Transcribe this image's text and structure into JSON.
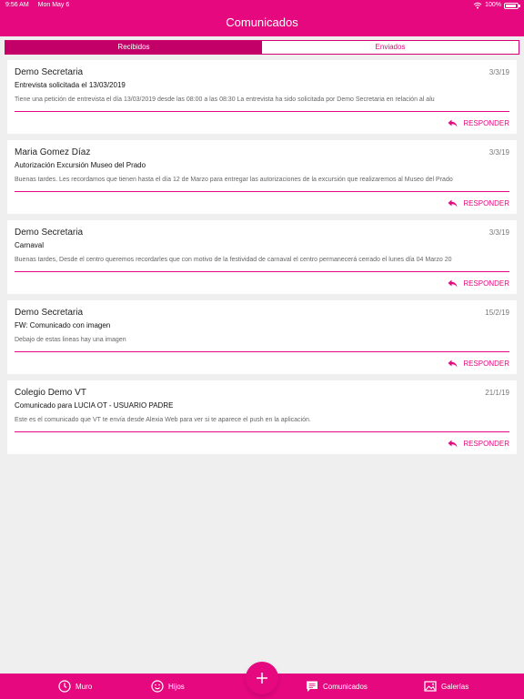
{
  "status": {
    "time": "9:56 AM",
    "date": "Mon May 6",
    "battery": "100%"
  },
  "header": {
    "title": "Comunicados"
  },
  "tabs": [
    {
      "label": "Recibidos"
    },
    {
      "label": "Enviados"
    }
  ],
  "messages": [
    {
      "sender": "Demo Secretaria",
      "date": "3/3/19",
      "subject": "Entrevista solicitada el 13/03/2019",
      "body": "Tiene una petición de entrevista el día 13/03/2019 desde las 08:00 a las 08:30 La entrevista ha sido solicitada por Demo Secretaria en relación al alu",
      "reply": "RESPONDER"
    },
    {
      "sender": "Maria Gomez Díaz",
      "date": "3/3/19",
      "subject": "Autorización Excursión Museo del Prado",
      "body": "Buenas tardes. Les recordamos que tienen hasta el día 12 de Marzo para entregar las autorizaciones de la excursión que realizaremos al Museo del Prado",
      "reply": "RESPONDER"
    },
    {
      "sender": "Demo Secretaria",
      "date": "3/3/19",
      "subject": "Carnaval",
      "body": "Buenas tardes, Desde el centro queremos recordarles que con motivo de la festividad de carnaval el centro permanecerá cerrado el lunes día 04 Marzo 20",
      "reply": "RESPONDER"
    },
    {
      "sender": "Demo Secretaria",
      "date": "15/2/19",
      "subject": "FW: Comunicado con imagen",
      "body": "Debajo de estas lineas hay una imagen",
      "reply": "RESPONDER"
    },
    {
      "sender": "Colegio Demo VT",
      "date": "21/1/19",
      "subject": "Comunicado para LUCIA OT - USUARIO PADRE",
      "body": "Este es el comunicado que VT te envía desde Alexia Web para ver si te aparece el push en la aplicación.",
      "reply": "RESPONDER"
    }
  ],
  "nav": {
    "muro": "Muro",
    "hijos": "Hijos",
    "comunicados": "Comunicados",
    "galerias": "Galerías"
  },
  "icons": {
    "muro": "clock-icon",
    "hijos": "smiley-icon",
    "comunicados": "chat-icon",
    "galerias": "image-icon",
    "fab": "plus-icon",
    "reply": "reply-icon",
    "wifi": "wifi-icon",
    "battery": "battery-icon"
  },
  "colors": {
    "brand": "#e5087f",
    "active_tab": "#c20068",
    "background": "#efefef"
  }
}
